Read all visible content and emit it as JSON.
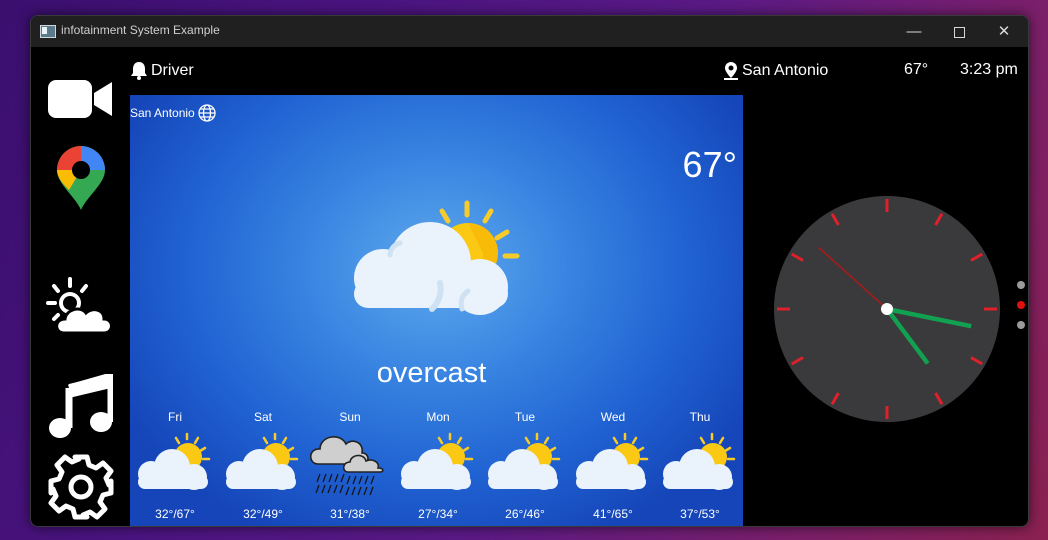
{
  "window": {
    "title": "infotainment System Example",
    "controls": {
      "minimize": "—",
      "maximize": "",
      "close": "✕"
    }
  },
  "sidebar": {
    "items": [
      {
        "name": "camera",
        "icon": "video-camera-icon"
      },
      {
        "name": "maps",
        "icon": "map-pin-icon"
      },
      {
        "name": "weather",
        "icon": "weather-icon"
      },
      {
        "name": "music",
        "icon": "music-note-icon"
      },
      {
        "name": "settings",
        "icon": "gear-icon"
      }
    ]
  },
  "topbar": {
    "profile": "Driver",
    "location": "San Antonio",
    "temperature": "67°",
    "time": "3:23 pm"
  },
  "weather": {
    "location": "San Antonio",
    "temperature": "67°",
    "condition": "overcast",
    "forecast": [
      {
        "day": "Fri",
        "range": "32°/67°",
        "icon": "partly-sunny-icon"
      },
      {
        "day": "Sat",
        "range": "32°/49°",
        "icon": "partly-sunny-icon"
      },
      {
        "day": "Sun",
        "range": "31°/38°",
        "icon": "rain-cloud-icon"
      },
      {
        "day": "Mon",
        "range": "27°/34°",
        "icon": "partly-sunny-icon"
      },
      {
        "day": "Tue",
        "range": "26°/46°",
        "icon": "partly-sunny-icon"
      },
      {
        "day": "Wed",
        "range": "41°/65°",
        "icon": "partly-sunny-icon"
      },
      {
        "day": "Thu",
        "range": "37°/53°",
        "icon": "partly-sunny-icon"
      }
    ]
  },
  "clock": {
    "hour": 3,
    "minute": 23,
    "second": 52,
    "face_color": "#3a3a3c",
    "tick_color": "#e0202a",
    "hand_color": "#12a150",
    "second_hand_color": "#b01818"
  },
  "pager": {
    "pages": 3,
    "active_index": 1
  }
}
